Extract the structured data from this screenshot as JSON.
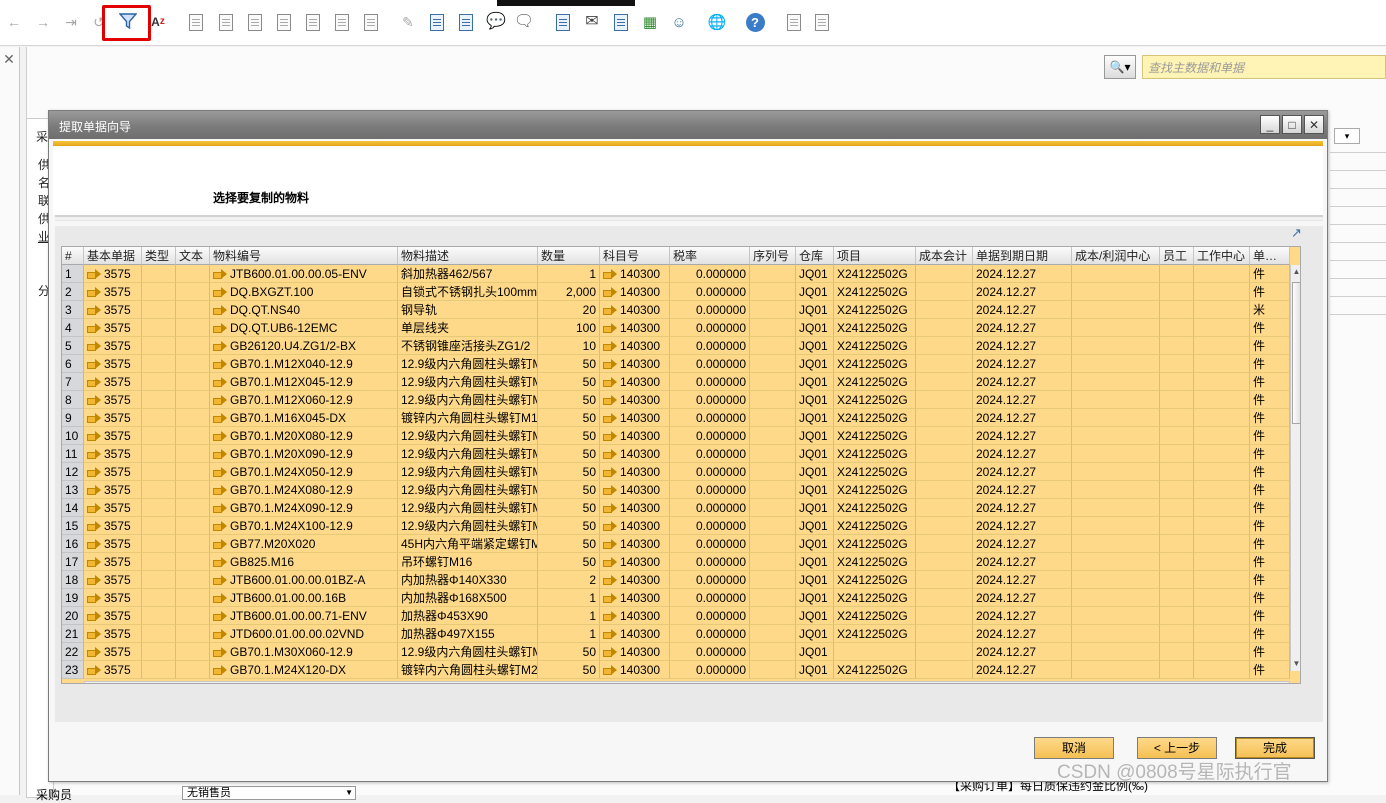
{
  "toolbar": {
    "icons": [
      "back-arrow-icon",
      "forward-arrow-icon",
      "last-record-icon",
      "refresh-icon",
      "filter-icon",
      "sort-az-icon",
      "copy-from-icon",
      "copy-to-icon",
      "document-icon",
      "base-document-icon",
      "relationship-map-icon",
      "journal-icon",
      "preview-icon",
      "edit-icon",
      "new-document-icon",
      "approval-icon",
      "message-icon",
      "messages-list-icon",
      "activity-icon",
      "email-icon",
      "calendar-icon",
      "organization-chart-icon",
      "user-icon",
      "web-icon",
      "help-icon",
      "settings-icon",
      "report-icon"
    ]
  },
  "search": {
    "placeholder": "查找主数据和单据"
  },
  "background": {
    "side_chars": [
      "采",
      "供",
      "名",
      "联",
      "供",
      "业",
      "分"
    ]
  },
  "dialog": {
    "title": "提取单据向导",
    "subtitle": "选择要复制的物料",
    "columns": [
      "#",
      "基本单据",
      "类型",
      "文本",
      "物料编号",
      "物料描述",
      "数量",
      "科目号",
      "税率",
      "序列号",
      "仓库",
      "项目",
      "成本会计",
      "单据到期日期",
      "成本/利润中心",
      "员工",
      "工作中心",
      "单…"
    ],
    "rows": [
      {
        "n": "1",
        "base": "3575",
        "item": "JTB600.01.00.00.05-ENV",
        "desc": "斜加热器462/567",
        "qty": "1",
        "acct": "140300",
        "tax": "0.000000",
        "wh": "JQ01",
        "proj": "X241225​02G",
        "date": "2024.12.27",
        "unit": "件"
      },
      {
        "n": "2",
        "base": "3575",
        "item": "DQ.BXGZT.100",
        "desc": "自锁式不锈钢扎头100mm",
        "qty": "2,000",
        "acct": "140300",
        "tax": "0.000000",
        "wh": "JQ01",
        "proj": "X24122502G",
        "date": "2024.12.27",
        "unit": "件"
      },
      {
        "n": "3",
        "base": "3575",
        "item": "DQ.QT.NS40",
        "desc": "钢导轨",
        "qty": "20",
        "acct": "140300",
        "tax": "0.000000",
        "wh": "JQ01",
        "proj": "X24122502G",
        "date": "2024.12.27",
        "unit": "米"
      },
      {
        "n": "4",
        "base": "3575",
        "item": "DQ.QT.UB6-12EMC",
        "desc": "单层线夹",
        "qty": "100",
        "acct": "140300",
        "tax": "0.000000",
        "wh": "JQ01",
        "proj": "X24122502G",
        "date": "2024.12.27",
        "unit": "件"
      },
      {
        "n": "5",
        "base": "3575",
        "item": "GB26120.U4.ZG1/2-BX",
        "desc": "不锈钢锥座活接头ZG1/2",
        "qty": "10",
        "acct": "140300",
        "tax": "0.000000",
        "wh": "JQ01",
        "proj": "X24122502G",
        "date": "2024.12.27",
        "unit": "件"
      },
      {
        "n": "6",
        "base": "3575",
        "item": "GB70.1.M12X040-12.9",
        "desc": "12.9级内六角圆柱头螺钉M",
        "qty": "50",
        "acct": "140300",
        "tax": "0.000000",
        "wh": "JQ01",
        "proj": "X24122502G",
        "date": "2024.12.27",
        "unit": "件"
      },
      {
        "n": "7",
        "base": "3575",
        "item": "GB70.1.M12X045-12.9",
        "desc": "12.9级内六角圆柱头螺钉M",
        "qty": "50",
        "acct": "140300",
        "tax": "0.000000",
        "wh": "JQ01",
        "proj": "X24122502G",
        "date": "2024.12.27",
        "unit": "件"
      },
      {
        "n": "8",
        "base": "3575",
        "item": "GB70.1.M12X060-12.9",
        "desc": "12.9级内六角圆柱头螺钉M",
        "qty": "50",
        "acct": "140300",
        "tax": "0.000000",
        "wh": "JQ01",
        "proj": "X24122502G",
        "date": "2024.12.27",
        "unit": "件"
      },
      {
        "n": "9",
        "base": "3575",
        "item": "GB70.1.M16X045-DX",
        "desc": "镀锌内六角圆柱头螺钉M1",
        "qty": "50",
        "acct": "140300",
        "tax": "0.000000",
        "wh": "JQ01",
        "proj": "X24122502G",
        "date": "2024.12.27",
        "unit": "件"
      },
      {
        "n": "10",
        "base": "3575",
        "item": "GB70.1.M20X080-12.9",
        "desc": "12.9级内六角圆柱头螺钉M",
        "qty": "50",
        "acct": "140300",
        "tax": "0.000000",
        "wh": "JQ01",
        "proj": "X24122502G",
        "date": "2024.12.27",
        "unit": "件"
      },
      {
        "n": "11",
        "base": "3575",
        "item": "GB70.1.M20X090-12.9",
        "desc": "12.9级内六角圆柱头螺钉M",
        "qty": "50",
        "acct": "140300",
        "tax": "0.000000",
        "wh": "JQ01",
        "proj": "X24122502G",
        "date": "2024.12.27",
        "unit": "件"
      },
      {
        "n": "12",
        "base": "3575",
        "item": "GB70.1.M24X050-12.9",
        "desc": "12.9级内六角圆柱头螺钉M",
        "qty": "50",
        "acct": "140300",
        "tax": "0.000000",
        "wh": "JQ01",
        "proj": "X24122502G",
        "date": "2024.12.27",
        "unit": "件"
      },
      {
        "n": "13",
        "base": "3575",
        "item": "GB70.1.M24X080-12.9",
        "desc": "12.9级内六角圆柱头螺钉M",
        "qty": "50",
        "acct": "140300",
        "tax": "0.000000",
        "wh": "JQ01",
        "proj": "X24122502G",
        "date": "2024.12.27",
        "unit": "件"
      },
      {
        "n": "14",
        "base": "3575",
        "item": "GB70.1.M24X090-12.9",
        "desc": "12.9级内六角圆柱头螺钉M",
        "qty": "50",
        "acct": "140300",
        "tax": "0.000000",
        "wh": "JQ01",
        "proj": "X24122502G",
        "date": "2024.12.27",
        "unit": "件"
      },
      {
        "n": "15",
        "base": "3575",
        "item": "GB70.1.M24X100-12.9",
        "desc": "12.9级内六角圆柱头螺钉M",
        "qty": "50",
        "acct": "140300",
        "tax": "0.000000",
        "wh": "JQ01",
        "proj": "X24122502G",
        "date": "2024.12.27",
        "unit": "件"
      },
      {
        "n": "16",
        "base": "3575",
        "item": "GB77.M20X020",
        "desc": "45H内六角平端紧定螺钉M",
        "qty": "50",
        "acct": "140300",
        "tax": "0.000000",
        "wh": "JQ01",
        "proj": "X24122502G",
        "date": "2024.12.27",
        "unit": "件"
      },
      {
        "n": "17",
        "base": "3575",
        "item": "GB825.M16",
        "desc": "吊环螺钉M16",
        "qty": "50",
        "acct": "140300",
        "tax": "0.000000",
        "wh": "JQ01",
        "proj": "X24122502G",
        "date": "2024.12.27",
        "unit": "件"
      },
      {
        "n": "18",
        "base": "3575",
        "item": "JTB600.01.00.00.01BZ-A",
        "desc": "内加热器Φ140X330",
        "qty": "2",
        "acct": "140300",
        "tax": "0.000000",
        "wh": "JQ01",
        "proj": "X24122502G",
        "date": "2024.12.27",
        "unit": "件"
      },
      {
        "n": "19",
        "base": "3575",
        "item": "JTB600.01.00.00.16B",
        "desc": "内加热器Φ168X500",
        "qty": "1",
        "acct": "140300",
        "tax": "0.000000",
        "wh": "JQ01",
        "proj": "X24122502G",
        "date": "2024.12.27",
        "unit": "件"
      },
      {
        "n": "20",
        "base": "3575",
        "item": "JTB600.01.00.00.71-ENV",
        "desc": "加热器Φ453X90",
        "qty": "1",
        "acct": "140300",
        "tax": "0.000000",
        "wh": "JQ01",
        "proj": "X24122502G",
        "date": "2024.12.27",
        "unit": "件"
      },
      {
        "n": "21",
        "base": "3575",
        "item": "JTD600.01.00.00.02VND",
        "desc": "加热器Φ497X155",
        "qty": "1",
        "acct": "140300",
        "tax": "0.000000",
        "wh": "JQ01",
        "proj": "X24122502G",
        "date": "2024.12.27",
        "unit": "件"
      },
      {
        "n": "22",
        "base": "3575",
        "item": "GB70.1.M30X060-12.9",
        "desc": "12.9级内六角圆柱头螺钉M",
        "qty": "50",
        "acct": "140300",
        "tax": "0.000000",
        "wh": "JQ01",
        "proj": "",
        "date": "2024.12.27",
        "unit": "件"
      },
      {
        "n": "23",
        "base": "3575",
        "item": "GB70.1.M24X120-DX",
        "desc": "镀锌内六角圆柱头螺钉M2",
        "qty": "50",
        "acct": "140300",
        "tax": "0.000000",
        "wh": "JQ01",
        "proj": "X24122502G",
        "date": "2024.12.27",
        "unit": "件"
      }
    ],
    "buttons": {
      "cancel": "取消",
      "back": "< 上一步",
      "finish": "完成"
    }
  },
  "bottom": {
    "purchaser_label": "采购员",
    "purchaser_value": "无销售员",
    "status_text": "【采购订单】每日质保违约金比例(‰)",
    "watermark": "CSDN @0808号星际执行官"
  }
}
